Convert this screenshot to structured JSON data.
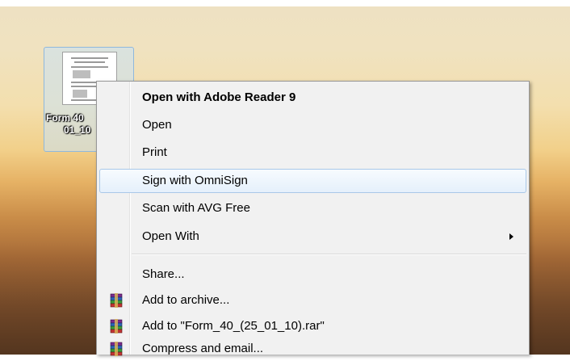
{
  "desktop": {
    "file_icon": {
      "name_line1": "Form 40",
      "name_line2": "01_10"
    }
  },
  "context_menu": {
    "items": [
      {
        "label": "Open with Adobe Reader 9",
        "bold": true
      },
      {
        "label": "Open"
      },
      {
        "label": "Print"
      },
      {
        "label": "Sign with OmniSign",
        "highlighted": true
      },
      {
        "label": "Scan with AVG Free"
      },
      {
        "label": "Open With",
        "submenu": true
      },
      {
        "label": "Share..."
      },
      {
        "label": "Add to archive...",
        "icon": "winrar-icon"
      },
      {
        "label": "Add to \"Form_40_(25_01_10).rar\"",
        "icon": "winrar-icon"
      },
      {
        "label": "Compress and email...",
        "icon": "winrar-icon"
      }
    ]
  },
  "colors": {
    "menu_bg": "#f1f1f1",
    "highlight_border": "#a9c8e8",
    "selection_bg": "#c8e1f5"
  }
}
